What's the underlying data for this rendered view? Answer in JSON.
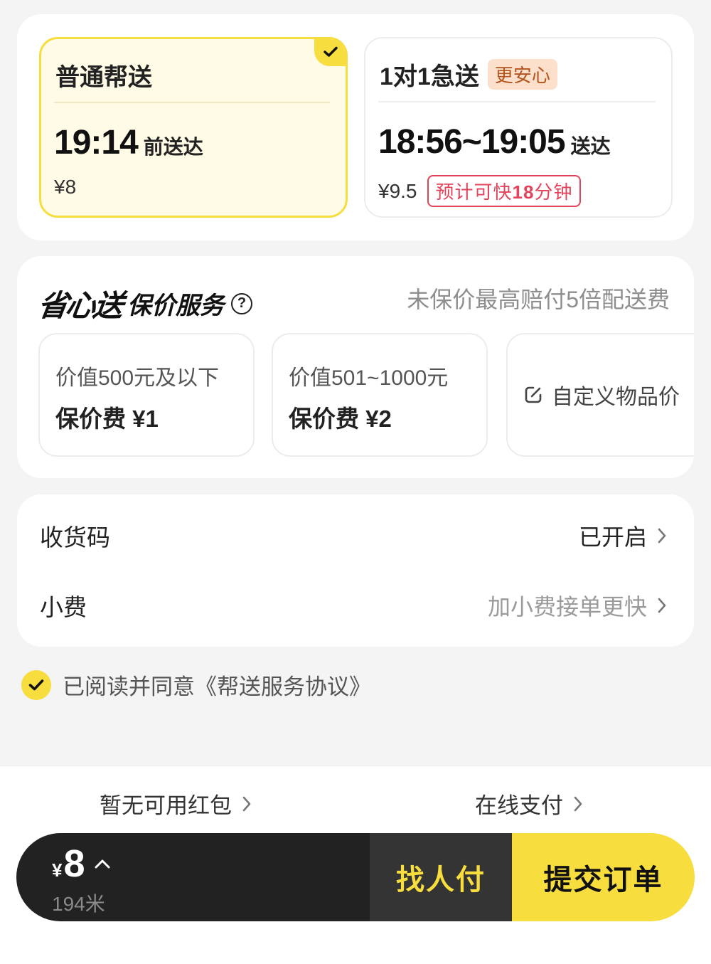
{
  "delivery": {
    "normal": {
      "title": "普通帮送",
      "time": "19:14",
      "time_suffix": "前送达",
      "price": "¥8",
      "selected": true
    },
    "express": {
      "title": "1对1急送",
      "tag": "更安心",
      "time": "18:56~19:05",
      "time_suffix": "送达",
      "price": "¥9.5",
      "faster_prefix": "预计可快",
      "faster_minutes": "18",
      "faster_suffix": "分钟"
    }
  },
  "insurance": {
    "brand_logo": "省心送",
    "title": "保价服务",
    "hint": "未保价最高赔付5倍配送费",
    "options": [
      {
        "range": "价值500元及以下",
        "fee": "保价费 ¥1"
      },
      {
        "range": "价值501~1000元",
        "fee": "保价费 ¥2"
      }
    ],
    "custom_label": "自定义物品价"
  },
  "settings": {
    "receipt_code": {
      "label": "收货码",
      "value": "已开启"
    },
    "tip": {
      "label": "小费",
      "value": "加小费接单更快"
    }
  },
  "agreement": {
    "checked": true,
    "text": "已阅读并同意《帮送服务协议》"
  },
  "footer": {
    "coupon": "暂无可用红包",
    "payment_method": "在线支付",
    "currency": "¥",
    "total": "8",
    "distance": "194米",
    "pay_other": "找人付",
    "submit": "提交订单"
  },
  "colors": {
    "accent_yellow": "#f7dd3d",
    "dark": "#222222",
    "red": "#e2445c",
    "green": "#18a35a"
  }
}
